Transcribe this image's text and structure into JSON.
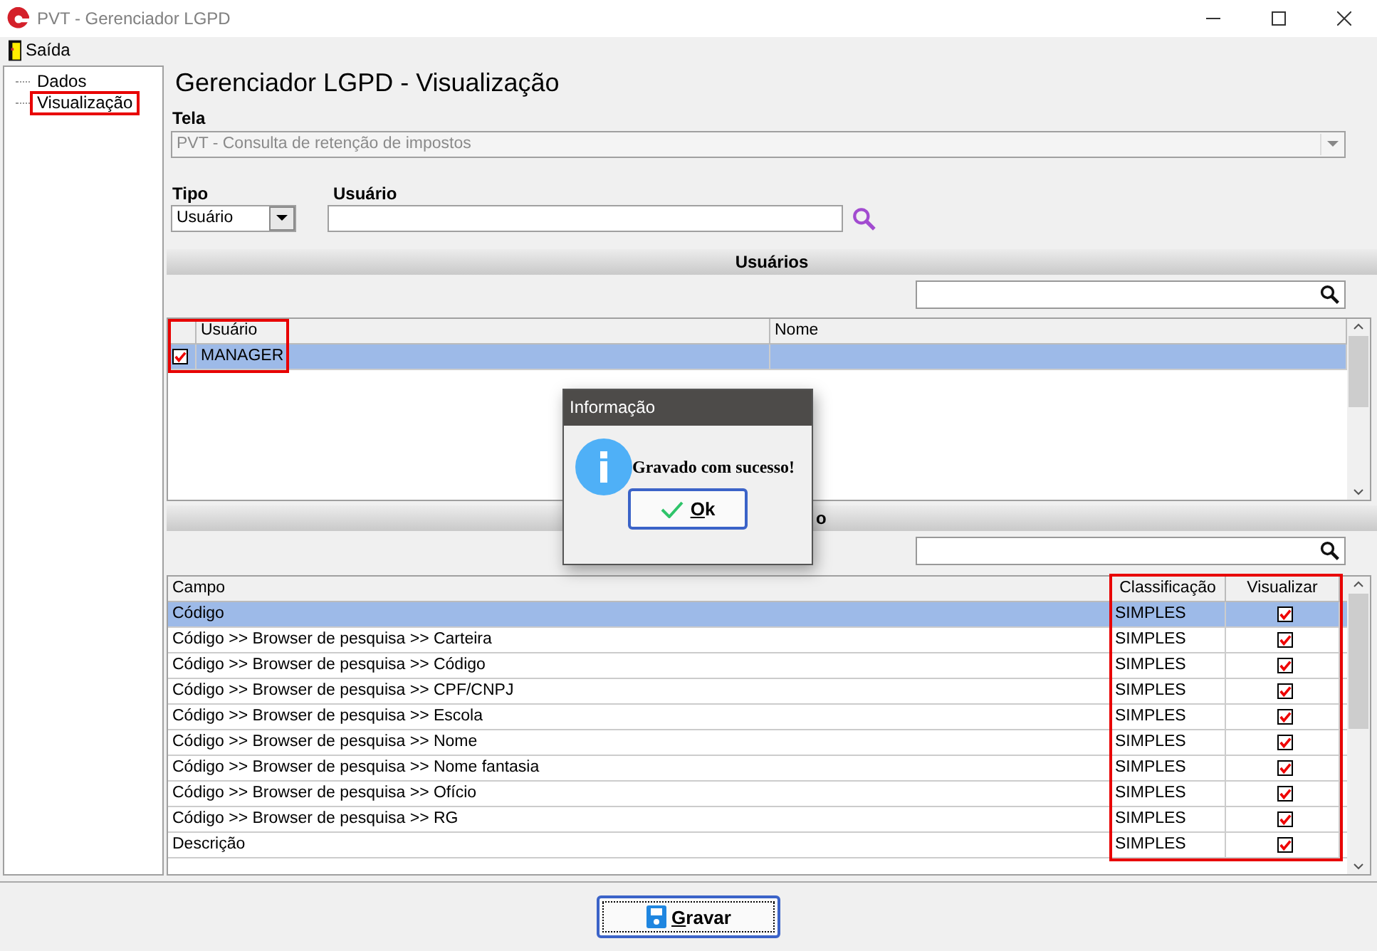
{
  "window": {
    "title": "PVT - Gerenciador LGPD"
  },
  "menu": [
    {
      "label": "Saída"
    }
  ],
  "tree": [
    {
      "label": "Dados",
      "highlighted": false
    },
    {
      "label": "Visualização",
      "highlighted": true
    }
  ],
  "heading": "Gerenciador LGPD - Visualização",
  "tela": {
    "label": "Tela",
    "value": "PVT - Consulta de retenção de impostos",
    "disabled": true
  },
  "tipo": {
    "label": "Tipo",
    "value": "Usuário"
  },
  "usuario": {
    "label": "Usuário"
  },
  "users_section": {
    "title": "Usuários",
    "highlighted": true,
    "columns": [
      "Usuário",
      "Nome"
    ],
    "rows": [
      {
        "checked": true,
        "selected": true,
        "cells": [
          "MANAGER",
          ""
        ]
      }
    ]
  },
  "fields_section": {
    "title": "o",
    "highlighted": true,
    "columns": [
      "Campo",
      "Classificação",
      "Visualizar"
    ],
    "rows": [
      {
        "campo": "Código",
        "classificacao": "SIMPLES",
        "checked": true,
        "selected": true
      },
      {
        "campo": "Código >> Browser de pesquisa >> Carteira",
        "classificacao": "SIMPLES",
        "checked": true,
        "selected": false
      },
      {
        "campo": "Código >> Browser de pesquisa >> Código",
        "classificacao": "SIMPLES",
        "checked": true,
        "selected": false
      },
      {
        "campo": "Código >> Browser de pesquisa >> CPF/CNPJ",
        "classificacao": "SIMPLES",
        "checked": true,
        "selected": false
      },
      {
        "campo": "Código >> Browser de pesquisa >> Escola",
        "classificacao": "SIMPLES",
        "checked": true,
        "selected": false
      },
      {
        "campo": "Código >> Browser de pesquisa >> Nome",
        "classificacao": "SIMPLES",
        "checked": true,
        "selected": false
      },
      {
        "campo": "Código >> Browser de pesquisa >> Nome fantasia",
        "classificacao": "SIMPLES",
        "checked": true,
        "selected": false
      },
      {
        "campo": "Código >> Browser de pesquisa >> Ofício",
        "classificacao": "SIMPLES",
        "checked": true,
        "selected": false
      },
      {
        "campo": "Código >> Browser de pesquisa >> RG",
        "classificacao": "SIMPLES",
        "checked": true,
        "selected": false
      },
      {
        "campo": "Descrição",
        "classificacao": "SIMPLES",
        "checked": true,
        "selected": false
      }
    ]
  },
  "dialog": {
    "title": "Informação",
    "message": "Gravado com sucesso!",
    "button": {
      "accel": "O",
      "rest": "k"
    }
  },
  "save_button": {
    "accel": "G",
    "rest": "ravar"
  }
}
